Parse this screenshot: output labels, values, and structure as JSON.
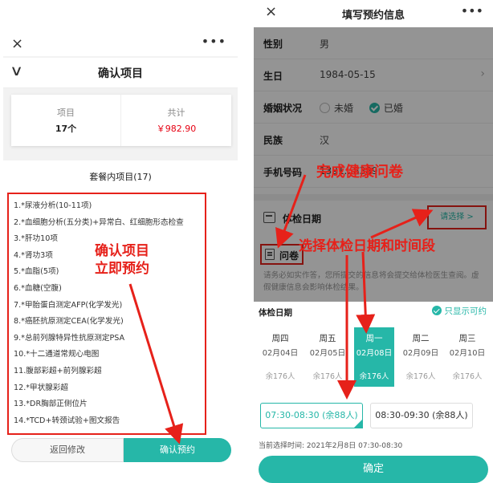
{
  "left": {
    "close_icon": "×",
    "more_icon": "•••",
    "back_icon": "∨",
    "title": "确认项目",
    "summary": {
      "items_label": "项目",
      "items_value": "17个",
      "total_label": "共计",
      "total_value": "￥982.90"
    },
    "package_title": "套餐内项目(17)",
    "package_items": [
      "1.*尿液分析(10-11项)",
      "2.*血细胞分析(五分类)+异常白、红细胞形态检查",
      "3.*肝功10项",
      "4.*肾功3项",
      "5.*血脂(5项)",
      "6.*血糖(空腹)",
      "7.*甲胎蛋白测定AFP(化学发光)",
      "8.*癌胚抗原测定CEA(化学发光)",
      "9.*总前列腺特异性抗原测定PSA",
      "10.*十二通道常规心电图",
      "11.腹部彩超+前列腺彩超",
      "12.*甲状腺彩超",
      "13.*DR胸部正侧位片",
      "14.*TCD+转颈试验+图文报告"
    ],
    "back_button": "返回修改",
    "confirm_button": "确认预约"
  },
  "annotations": {
    "left_line1": "确认项目",
    "left_line2": "立即预约",
    "right_top": "完成健康问卷",
    "right_mid": "选择体检日期和时间段"
  },
  "right": {
    "close_icon": "×",
    "more_icon": "•••",
    "title": "填写预约信息",
    "form": {
      "gender_label": "性别",
      "gender_value": "男",
      "birthday_label": "生日",
      "birthday_value": "1984-05-15",
      "marriage_label": "婚姻状况",
      "unmarried": "未婚",
      "married": "已婚",
      "ethnicity_label": "民族",
      "ethnicity_value": "汉",
      "phone_label": "手机号码",
      "phone_value": "1391...8389"
    },
    "exam_date_label": "体检日期",
    "exam_date_pick": "请选择 >",
    "questionnaire_label": "问卷",
    "questionnaire_desc": "请务必如实作答，您所提交的信息将会提交给体检医生查阅。虚假健康信息会影响体检结果。",
    "sheet": {
      "title": "体检日期",
      "only_available": "只显示可约",
      "days": [
        {
          "week": "周四",
          "date": "02月04日",
          "remain": "余176人"
        },
        {
          "week": "周五",
          "date": "02月05日",
          "remain": "余176人"
        },
        {
          "week": "周一",
          "date": "02月08日",
          "remain": "余176人"
        },
        {
          "week": "周二",
          "date": "02月09日",
          "remain": "余176人"
        },
        {
          "week": "周三",
          "date": "02月10日",
          "remain": "余176人"
        }
      ],
      "selected_day_index": 2,
      "slots": [
        "07:30-08:30 (余88人)",
        "08:30-09:30 (余88人)"
      ],
      "current_selection": "当前选择时间: 2021年2月8日 07:30-08:30",
      "confirm": "确定"
    }
  },
  "colors": {
    "accent": "#26b7a8",
    "annotation_red": "#e6211a",
    "price_red": "#e60012"
  }
}
